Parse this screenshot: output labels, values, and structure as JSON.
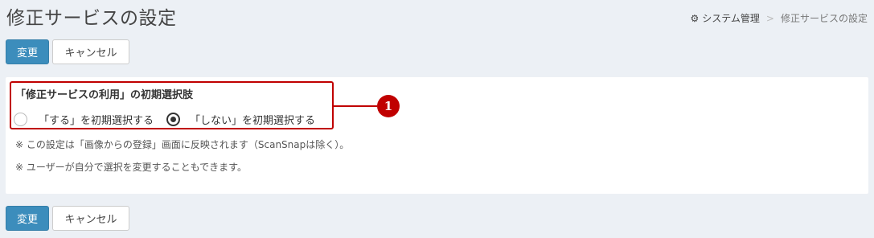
{
  "header": {
    "title": "修正サービスの設定",
    "breadcrumb": {
      "icon": "gear-icon",
      "parent": "システム管理",
      "separator": ">",
      "current": "修正サービスの設定"
    }
  },
  "toolbar": {
    "save_label": "変更",
    "cancel_label": "キャンセル"
  },
  "setting": {
    "label": "「修正サービスの利用」の初期選択肢",
    "options": [
      {
        "label": "「する」を初期選択する",
        "checked": false
      },
      {
        "label": "「しない」を初期選択する",
        "checked": true
      }
    ],
    "notes": [
      "※ この設定は「画像からの登録」画面に反映されます（ScanSnapは除く）。",
      "※ ユーザーが自分で選択を変更することもできます。"
    ]
  },
  "annotation": {
    "marker": "1"
  },
  "colors": {
    "primary": "#3c8dbc",
    "highlight": "#c00000",
    "background": "#ecf0f5"
  }
}
